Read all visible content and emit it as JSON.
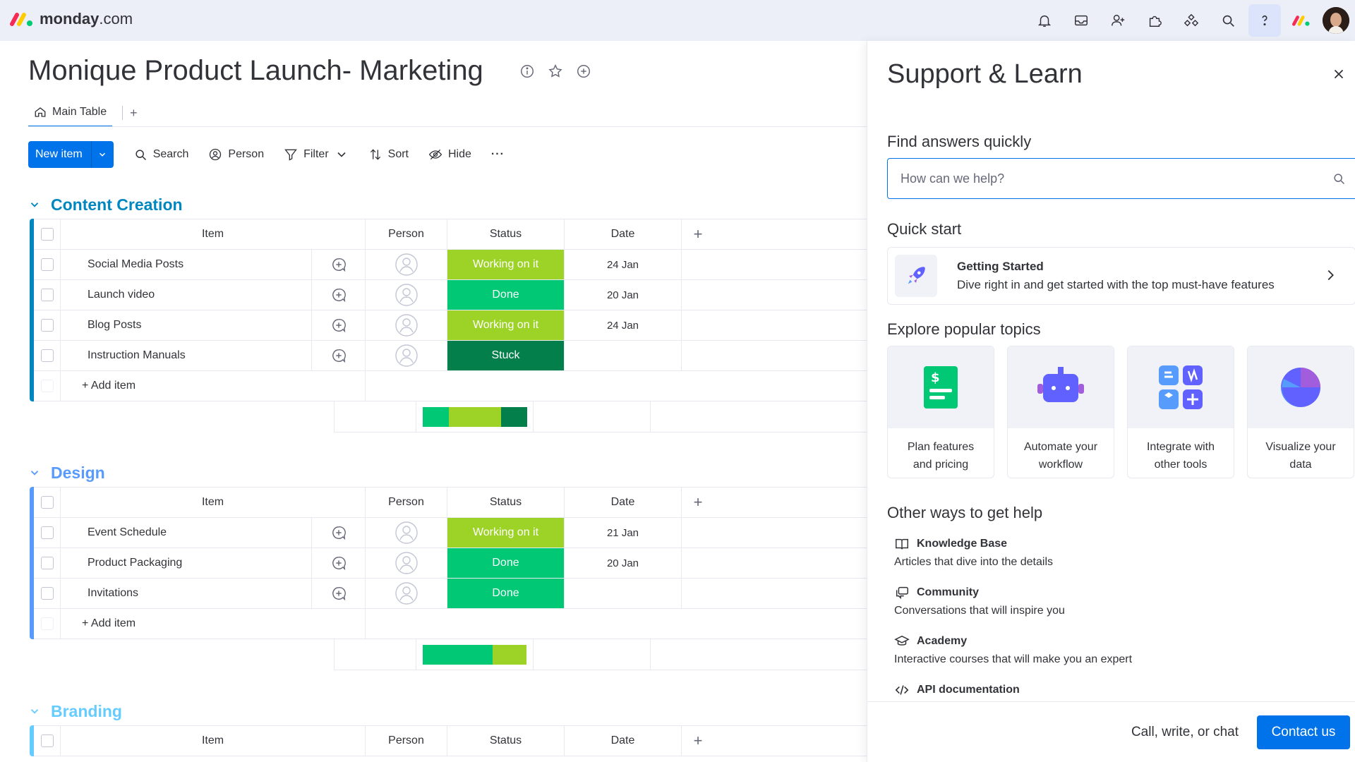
{
  "app": {
    "brand_name": "monday",
    "brand_suffix": ".com"
  },
  "board": {
    "title": "Monique Product Launch- Marketing",
    "tabs": [
      {
        "label": "Main Table"
      }
    ],
    "tab_add": "+"
  },
  "toolbar": {
    "new_item": "New item",
    "search": "Search",
    "person": "Person",
    "filter": "Filter",
    "sort": "Sort",
    "hide": "Hide",
    "more": "···"
  },
  "columns": {
    "item": "Item",
    "person": "Person",
    "status": "Status",
    "date": "Date"
  },
  "status_colors": {
    "Working on it": "#9cd326",
    "Done": "#00c875",
    "Stuck": "#037f4c"
  },
  "groups": [
    {
      "name": "Content Creation",
      "color": "#0086c0",
      "rows": [
        {
          "item": "Social Media Posts",
          "status": "Working on it",
          "date": "24 Jan"
        },
        {
          "item": "Launch video",
          "status": "Done",
          "date": "20 Jan"
        },
        {
          "item": "Blog Posts",
          "status": "Working on it",
          "date": "24 Jan"
        },
        {
          "item": "Instruction Manuals",
          "status": "Stuck",
          "date": ""
        }
      ],
      "add_item": "+ Add item",
      "summary": [
        {
          "status": "Done",
          "fraction": 0.25
        },
        {
          "status": "Working on it",
          "fraction": 0.5
        },
        {
          "status": "Stuck",
          "fraction": 0.25
        }
      ]
    },
    {
      "name": "Design",
      "color": "#579bfc",
      "rows": [
        {
          "item": "Event Schedule",
          "status": "Working on it",
          "date": "21 Jan"
        },
        {
          "item": "Product Packaging",
          "status": "Done",
          "date": "20 Jan"
        },
        {
          "item": "Invitations",
          "status": "Done",
          "date": ""
        }
      ],
      "add_item": "+ Add item",
      "summary": [
        {
          "status": "Done",
          "fraction": 0.67
        },
        {
          "status": "Working on it",
          "fraction": 0.33
        }
      ]
    },
    {
      "name": "Branding",
      "color": "#66ccff",
      "rows": [],
      "add_item": "",
      "summary": []
    }
  ],
  "panel": {
    "title": "Support & Learn",
    "find_heading": "Find answers quickly",
    "search_placeholder": "How can we help?",
    "quick_start_heading": "Quick start",
    "getting_started_title": "Getting Started",
    "getting_started_desc": "Dive right in and get started with the top must-have features",
    "explore_heading": "Explore popular topics",
    "topics": [
      {
        "line1": "Plan features",
        "line2": "and pricing"
      },
      {
        "line1": "Automate your",
        "line2": "workflow"
      },
      {
        "line1": "Integrate with",
        "line2": "other tools"
      },
      {
        "line1": "Visualize your",
        "line2": "data"
      }
    ],
    "other_heading": "Other ways to get help",
    "help_items": [
      {
        "title": "Knowledge Base",
        "desc": "Articles that dive into the details"
      },
      {
        "title": "Community",
        "desc": "Conversations that will inspire you"
      },
      {
        "title": "Academy",
        "desc": "Interactive courses that will make you an expert"
      },
      {
        "title": "API documentation",
        "desc": ""
      }
    ],
    "footer_text": "Call, write, or chat",
    "contact_button": "Contact us"
  }
}
